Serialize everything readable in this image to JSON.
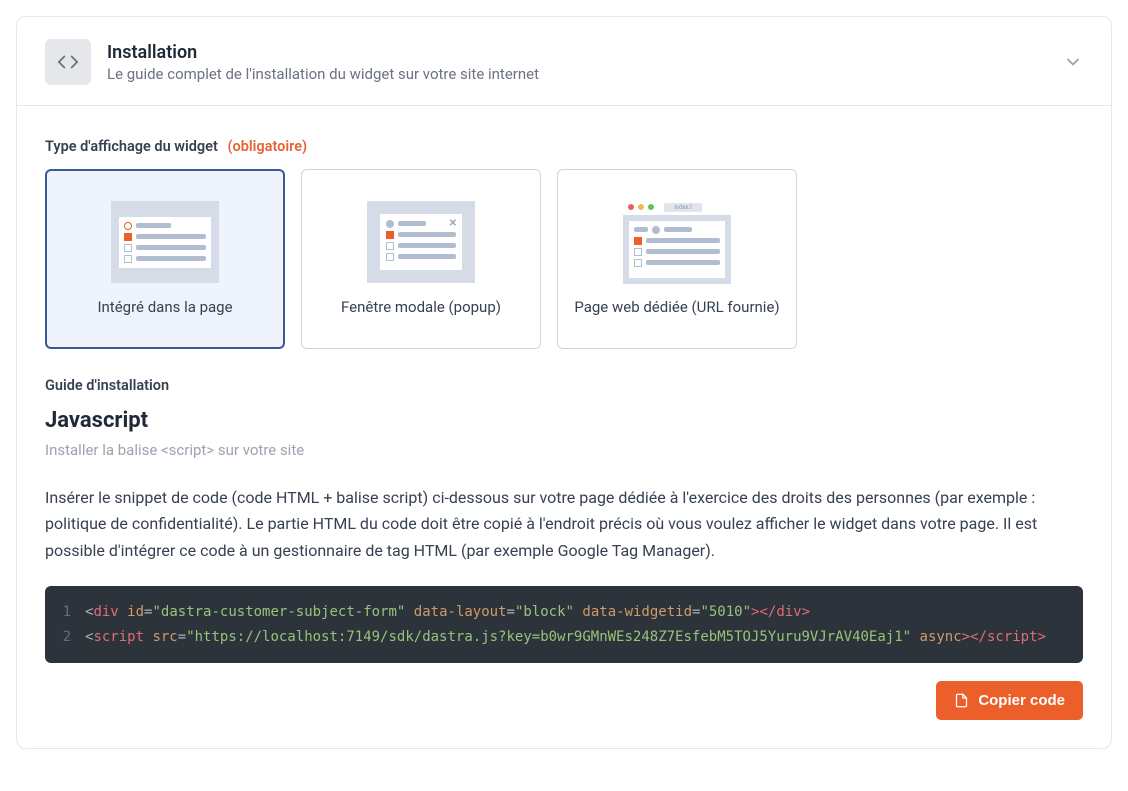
{
  "header": {
    "title": "Installation",
    "subtitle": "Le guide complet de l'installation du widget sur votre site internet"
  },
  "display_type": {
    "label": "Type d'affichage du widget",
    "required_text": "(obligatoire)",
    "options": [
      {
        "label": "Intégré dans la page",
        "selected": true
      },
      {
        "label": "Fenêtre modale (popup)",
        "selected": false
      },
      {
        "label": "Page web dédiée (URL fournie)",
        "selected": false
      }
    ]
  },
  "guide": {
    "section_label": "Guide d'installation",
    "title": "Javascript",
    "subtitle": "Installer la balise <script> sur votre site",
    "description": "Insérer le snippet de code (code HTML + balise script) ci-dessous sur votre page dédiée à l'exercice des droits des personnes (par exemple : politique de confidentialité). Le partie HTML du code doit être copié à l'endroit précis où vous voulez afficher le widget dans votre page. Il est possible d'intégrer ce code à un gestionnaire de tag HTML (par exemple Google Tag Manager)."
  },
  "code": {
    "line1": {
      "tag": "div",
      "attrs": {
        "id": "dastra-customer-subject-form",
        "data-layout": "block",
        "data-widgetid": "5010"
      }
    },
    "line2": {
      "tag": "script",
      "attrs": {
        "src": "https://localhost:7149/sdk/dastra.js?key=b0wr9GMnWEs248Z7EsfebM5TOJ5Yuru9VJrAV40Eaj1",
        "async": true
      }
    },
    "gutters": [
      "1",
      "2"
    ]
  },
  "actions": {
    "copy_label": "Copier code"
  }
}
